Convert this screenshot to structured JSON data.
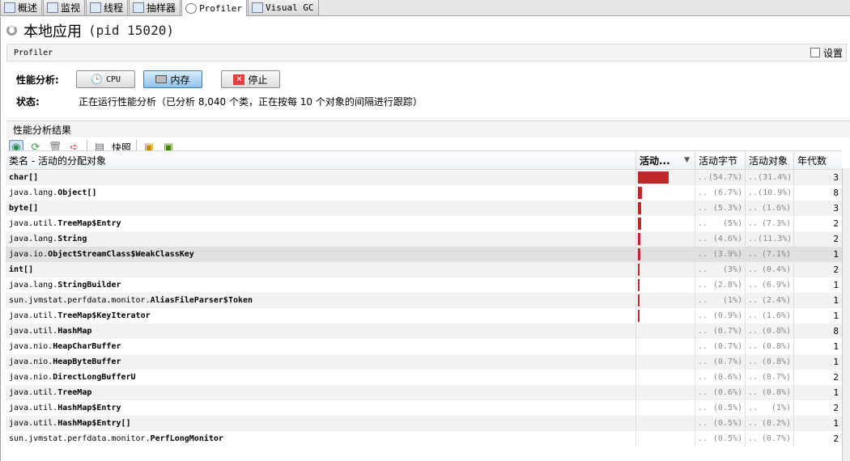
{
  "tabs": [
    {
      "label": "概述",
      "icon": "info-icon"
    },
    {
      "label": "监视",
      "icon": "chart-icon"
    },
    {
      "label": "线程",
      "icon": "threads-icon"
    },
    {
      "label": "抽样器",
      "icon": "sampler-icon"
    },
    {
      "label": "Profiler",
      "icon": "clock-icon",
      "active": true
    },
    {
      "label": "Visual GC",
      "icon": "gc-icon"
    }
  ],
  "header": {
    "title": "本地应用",
    "pid": "(pid 15020)"
  },
  "profiler_bar": {
    "label": "Profiler",
    "settings_label": "设置",
    "settings_checked": false
  },
  "controls": {
    "label": "性能分析:",
    "cpu": "CPU",
    "memory": "内存",
    "stop": "停止",
    "active": "memory"
  },
  "status": {
    "label": "状态:",
    "text": "正在运行性能分析（已分析 8,040 个类，正在按每 10 个对象的间隔进行跟踪）"
  },
  "results": {
    "title": "性能分析结果",
    "snapshot": "快照"
  },
  "table": {
    "columns": [
      "类名 - 活动的分配对象",
      "活动...",
      "活动字节",
      "活动对象",
      "年代数"
    ],
    "sort_column": "活动...",
    "bar_color": "#c0262a",
    "rows": [
      {
        "pkg": "",
        "cls": "char[]",
        "bytes": "(54.7%)",
        "objs": "(31.4%)",
        "gen": "3",
        "pct": 54.7
      },
      {
        "pkg": "java.lang.",
        "cls": "Object[]",
        "bytes": "(6.7%)",
        "objs": "(10.9%)",
        "gen": "8",
        "pct": 6.7
      },
      {
        "pkg": "",
        "cls": "byte[]",
        "bytes": "(5.3%)",
        "objs": "(1.6%)",
        "gen": "3",
        "pct": 5.3
      },
      {
        "pkg": "java.util.",
        "cls": "TreeMap$Entry",
        "bytes": "(5%)",
        "objs": "(7.3%)",
        "gen": "2",
        "pct": 5
      },
      {
        "pkg": "java.lang.",
        "cls": "String",
        "bytes": "(4.6%)",
        "objs": "(11.3%)",
        "gen": "2",
        "pct": 4.6
      },
      {
        "pkg": "java.io.",
        "cls": "ObjectStreamClass$WeakClassKey",
        "bytes": "(3.9%)",
        "objs": "(7.1%)",
        "gen": "1",
        "pct": 3.9,
        "selected": true
      },
      {
        "pkg": "",
        "cls": "int[]",
        "bytes": "(3%)",
        "objs": "(0.4%)",
        "gen": "2",
        "pct": 3
      },
      {
        "pkg": "java.lang.",
        "cls": "StringBuilder",
        "bytes": "(2.8%)",
        "objs": "(6.9%)",
        "gen": "1",
        "pct": 2.8
      },
      {
        "pkg": "sun.jvmstat.perfdata.monitor.",
        "cls": "AliasFileParser$Token",
        "bytes": "(1%)",
        "objs": "(2.4%)",
        "gen": "1",
        "pct": 1
      },
      {
        "pkg": "java.util.",
        "cls": "TreeMap$KeyIterator",
        "bytes": "(0.9%)",
        "objs": "(1.6%)",
        "gen": "1",
        "pct": 0.9
      },
      {
        "pkg": "java.util.",
        "cls": "HashMap",
        "bytes": "(0.7%)",
        "objs": "(0.8%)",
        "gen": "8",
        "pct": 0.7
      },
      {
        "pkg": "java.nio.",
        "cls": "HeapCharBuffer",
        "bytes": "(0.7%)",
        "objs": "(0.8%)",
        "gen": "1",
        "pct": 0.7
      },
      {
        "pkg": "java.nio.",
        "cls": "HeapByteBuffer",
        "bytes": "(0.7%)",
        "objs": "(0.8%)",
        "gen": "1",
        "pct": 0.7
      },
      {
        "pkg": "java.nio.",
        "cls": "DirectLongBufferU",
        "bytes": "(0.6%)",
        "objs": "(0.7%)",
        "gen": "2",
        "pct": 0.6
      },
      {
        "pkg": "java.util.",
        "cls": "TreeMap",
        "bytes": "(0.6%)",
        "objs": "(0.8%)",
        "gen": "1",
        "pct": 0.6
      },
      {
        "pkg": "java.util.",
        "cls": "HashMap$Entry",
        "bytes": "(0.5%)",
        "objs": "(1%)",
        "gen": "2",
        "pct": 0.5
      },
      {
        "pkg": "java.util.",
        "cls": "HashMap$Entry[]",
        "bytes": "(0.5%)",
        "objs": "(0.2%)",
        "gen": "1",
        "pct": 0.5
      },
      {
        "pkg": "sun.jvmstat.perfdata.monitor.",
        "cls": "PerfLongMonitor",
        "bytes": "(0.5%)",
        "objs": "(0.7%)",
        "gen": "2",
        "pct": 0.5
      }
    ]
  }
}
